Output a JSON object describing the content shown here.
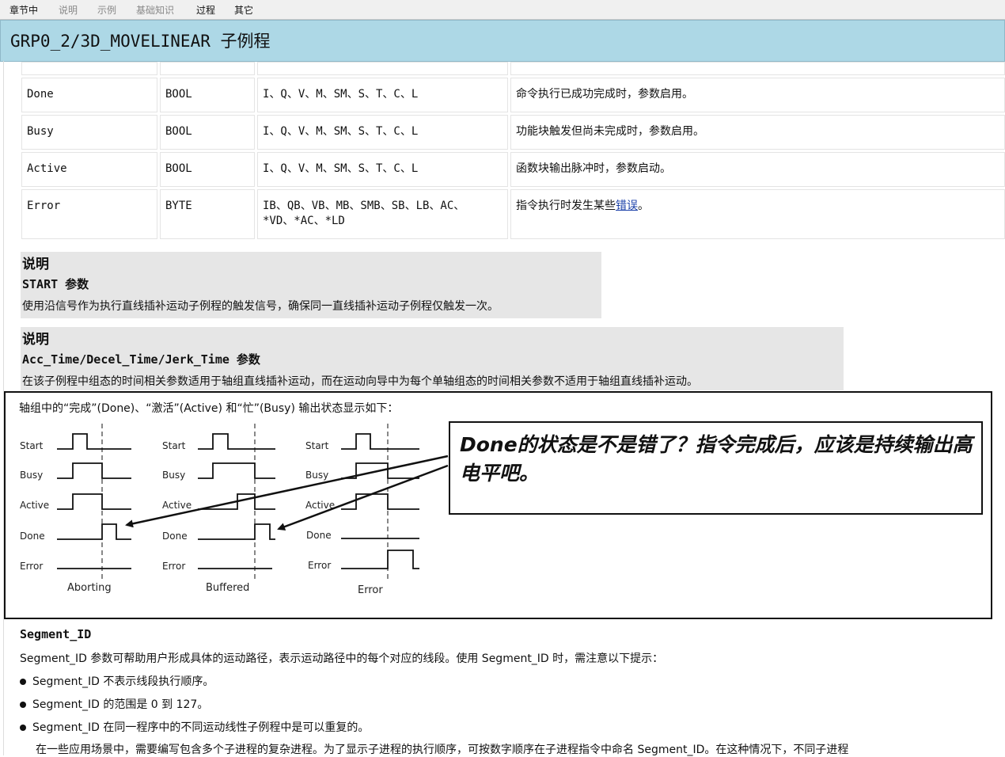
{
  "tabs": [
    "章节中",
    "说明",
    "示例",
    "基础知识",
    "过程",
    "其它"
  ],
  "page_title": "GRP0_2/3D_MOVELINEAR 子例程",
  "table_rows": [
    {
      "name": "Done",
      "type": "BOOL",
      "operands": "I、Q、V、M、SM、S、T、C、L",
      "desc": "命令执行已成功完成时，参数启用。"
    },
    {
      "name": "Busy",
      "type": "BOOL",
      "operands": "I、Q、V、M、SM、S、T、C、L",
      "desc": "功能块触发但尚未完成时，参数启用。"
    },
    {
      "name": "Active",
      "type": "BOOL",
      "operands": "I、Q、V、M、SM、S、T、C、L",
      "desc": "函数块输出脉冲时，参数启动。"
    },
    {
      "name": "Error",
      "type": "BYTE",
      "operands_line1": "IB、QB、VB、MB、SMB、SB、LB、AC、",
      "operands_line2": "*VD、*AC、*LD",
      "desc_prefix": "指令执行时发生某些",
      "desc_link": "错误",
      "desc_suffix": "。"
    }
  ],
  "note1": {
    "heading": "说明",
    "subheading": "START 参数",
    "text": "使用沿信号作为执行直线插补运动子例程的触发信号，确保同一直线插补运动子例程仅触发一次。"
  },
  "note2": {
    "heading": "说明",
    "subheading": "Acc_Time/Decel_Time/Jerk_Time 参数",
    "text": "在该子例程中组态的时间相关参数适用于轴组直线插补运动，而在运动向导中为每个单轴组态的时间相关参数不适用于轴组直线插补运动。"
  },
  "diagram": {
    "intro": "轴组中的“完成”(Done)、“激活”(Active) 和“忙”(Busy) 输出状态显示如下：",
    "signal_labels": [
      "Start",
      "Busy",
      "Active",
      "Done",
      "Error"
    ],
    "captions": [
      "Aborting",
      "Buffered",
      "Error"
    ]
  },
  "callout": {
    "text": "Done的状态是不是错了？指令完成后，应该是持续输出高电平吧。"
  },
  "segment": {
    "title": "Segment_ID",
    "intro": "Segment_ID 参数可帮助用户形成具体的运动路径，表示运动路径中的每个对应的线段。使用 Segment_ID 时，需注意以下提示：",
    "bullets": [
      "Segment_ID 不表示线段执行顺序。",
      "Segment_ID 的范围是 0 到 127。",
      "Segment_ID 在同一程序中的不同运动线性子例程中是可以重复的。"
    ],
    "trailing": "在一些应用场景中，需要编写包含多个子进程的复杂进程。为了显示子进程的执行顺序，可按数字顺序在子进程指令中命名 Segment_ID。在这种情况下，不同子进程"
  },
  "colors": {
    "header_bg": "#add8e6",
    "tab_bar_bg": "#f0f0f0",
    "note_bg": "#e6e6e6",
    "link": "#1a3fa8"
  }
}
